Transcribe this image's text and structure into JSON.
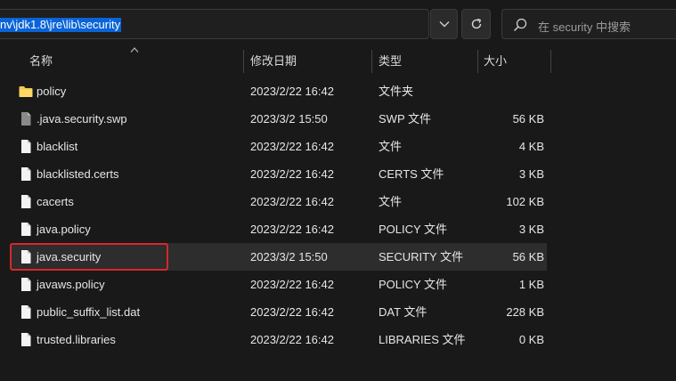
{
  "address_bar": {
    "path": "nv\\jdk1.8\\jre\\lib\\security"
  },
  "search": {
    "placeholder": "在 security 中搜索"
  },
  "columns": {
    "name": "名称",
    "date": "修改日期",
    "type": "类型",
    "size": "大小"
  },
  "files": [
    {
      "name": "policy",
      "date": "2023/2/22 16:42",
      "type": "文件夹",
      "size": "",
      "icon": "folder-icon"
    },
    {
      "name": ".java.security.swp",
      "date": "2023/3/2 15:50",
      "type": "SWP 文件",
      "size": "56 KB",
      "icon": "file-icon"
    },
    {
      "name": "blacklist",
      "date": "2023/2/22 16:42",
      "type": "文件",
      "size": "4 KB",
      "icon": "file-icon"
    },
    {
      "name": "blacklisted.certs",
      "date": "2023/2/22 16:42",
      "type": "CERTS 文件",
      "size": "3 KB",
      "icon": "file-icon"
    },
    {
      "name": "cacerts",
      "date": "2023/2/22 16:42",
      "type": "文件",
      "size": "102 KB",
      "icon": "file-icon"
    },
    {
      "name": "java.policy",
      "date": "2023/2/22 16:42",
      "type": "POLICY 文件",
      "size": "3 KB",
      "icon": "file-icon"
    },
    {
      "name": "java.security",
      "date": "2023/3/2 15:50",
      "type": "SECURITY 文件",
      "size": "56 KB",
      "icon": "file-icon",
      "highlighted": true
    },
    {
      "name": "javaws.policy",
      "date": "2023/2/22 16:42",
      "type": "POLICY 文件",
      "size": "1 KB",
      "icon": "file-icon"
    },
    {
      "name": "public_suffix_list.dat",
      "date": "2023/2/22 16:42",
      "type": "DAT 文件",
      "size": "228 KB",
      "icon": "file-icon"
    },
    {
      "name": "trusted.libraries",
      "date": "2023/2/22 16:42",
      "type": "LIBRARIES 文件",
      "size": "0 KB",
      "icon": "file-icon"
    }
  ],
  "colors": {
    "background": "#191919",
    "selection": "#0a64d8",
    "highlight_row": "#2d2d2d",
    "annotation_box": "#d8282a",
    "folder": "#f2c94c"
  }
}
